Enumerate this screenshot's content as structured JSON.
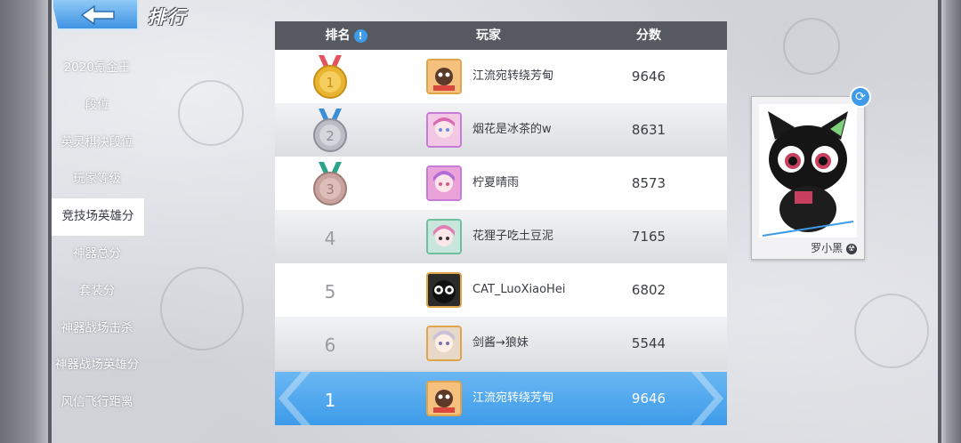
{
  "header": {
    "title": "排行",
    "back_icon": "back-arrow-icon"
  },
  "sidebar": {
    "items": [
      {
        "label": "2020氪金王",
        "active": false
      },
      {
        "label": "段位",
        "active": false
      },
      {
        "label": "英灵棋决段位",
        "active": false
      },
      {
        "label": "玩家等级",
        "active": false
      },
      {
        "label": "竞技场英雄分",
        "active": true
      },
      {
        "label": "神器总分",
        "active": false
      },
      {
        "label": "套装分",
        "active": false
      },
      {
        "label": "神器战场击杀",
        "active": false
      },
      {
        "label": "神器战场英雄分",
        "active": false
      },
      {
        "label": "风信飞行距离",
        "active": false
      }
    ]
  },
  "table": {
    "headers": {
      "rank": "排名",
      "player": "玩家",
      "score": "分数"
    },
    "rows": [
      {
        "rank": "1",
        "medal": "gold",
        "player": "江流宛转绕芳甸",
        "score": "9646"
      },
      {
        "rank": "2",
        "medal": "silver",
        "player": "烟花是冰茶的w",
        "score": "8631"
      },
      {
        "rank": "3",
        "medal": "bronze",
        "player": "柠夏晴雨",
        "score": "8573"
      },
      {
        "rank": "4",
        "medal": "",
        "player": "花狸子吃土豆泥",
        "score": "7165"
      },
      {
        "rank": "5",
        "medal": "",
        "player": "CAT_LuoXiaoHei",
        "score": "6802"
      },
      {
        "rank": "6",
        "medal": "",
        "player": "剑酱→狼妹",
        "score": "5544"
      }
    ],
    "self_row": {
      "rank": "1",
      "player": "江流宛转绕芳甸",
      "score": "9646"
    }
  },
  "profile": {
    "name": "罗小黑",
    "refresh_icon": "refresh-icon",
    "badge_icon": "radiation-icon"
  },
  "colors": {
    "accent": "#3d9be9",
    "header_bg": "#565960",
    "gold": "#e9b530",
    "silver": "#b9bcc4",
    "bronze": "#c9a49e"
  }
}
